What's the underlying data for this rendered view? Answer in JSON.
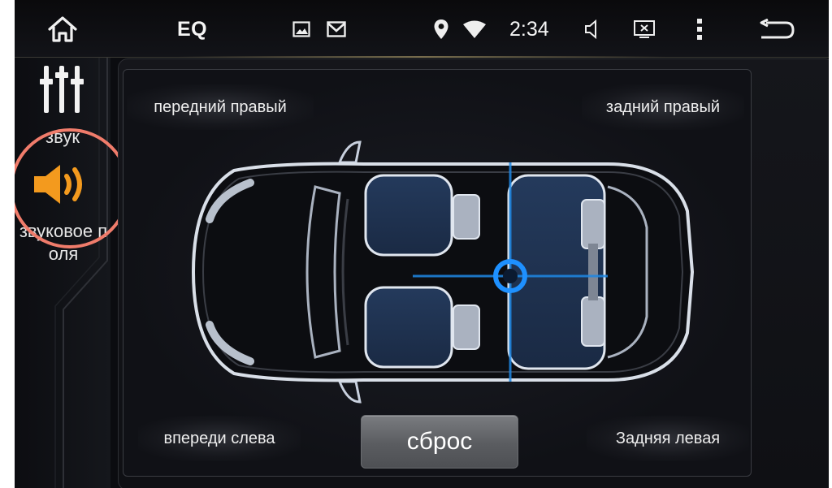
{
  "statusbar": {
    "title": "EQ",
    "time": "2:34",
    "icons": [
      "home-icon",
      "gallery-icon",
      "mail-icon",
      "location-icon",
      "wifi-icon",
      "volume-icon",
      "screenshot-icon",
      "menu-icon",
      "back-icon"
    ]
  },
  "sidebar": {
    "items": [
      {
        "label": "звук",
        "icon": "equalizer-icon"
      },
      {
        "label": "звуковое поля",
        "icon": "speaker-icon",
        "active": true
      }
    ]
  },
  "sound_field": {
    "front_right": "передний правый",
    "rear_right": "задний правый",
    "front_left": "впереди слева",
    "rear_left": "Задняя левая",
    "reset": "сброс"
  },
  "colors": {
    "accent": "#f39a1e",
    "focus": "#1e88e5",
    "highlight_ring": "#f07c6b"
  }
}
